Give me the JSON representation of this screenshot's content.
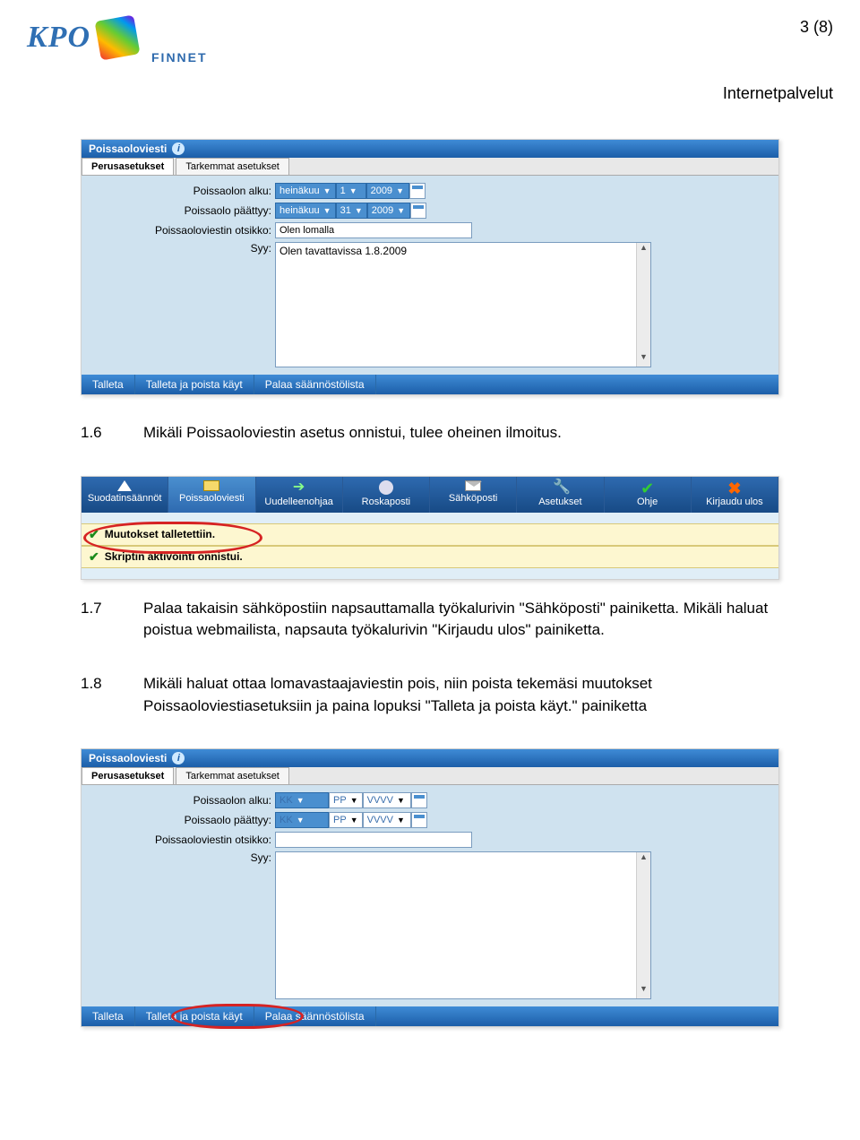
{
  "page_number": "3 (8)",
  "service_label": "Internetpalvelut",
  "logo": {
    "text": "KPO",
    "subtext": "FINNET"
  },
  "ui1": {
    "title": "Poissaoloviesti",
    "tabs": [
      "Perusasetukset",
      "Tarkemmat asetukset"
    ],
    "labels": {
      "start": "Poissaolon alku:",
      "end": "Poissaolo päättyy:",
      "subject": "Poissaoloviestin otsikko:",
      "reason": "Syy:"
    },
    "values": {
      "start_month": "heinäkuu",
      "start_day": "1",
      "start_year": "2009",
      "end_month": "heinäkuu",
      "end_day": "31",
      "end_year": "2009",
      "subject": "Olen lomalla",
      "reason": "Olen tavattavissa 1.8.2009"
    },
    "buttons": {
      "save": "Talleta",
      "save_remove": "Talleta ja poista käyt",
      "back": "Palaa säännöstölista"
    }
  },
  "para16_num": "1.6",
  "para16_txt": "Mikäli Poissaoloviestin asetus onnistui, tulee oheinen ilmoitus.",
  "toolbar": {
    "items": [
      "Suodatinsäännöt",
      "Poissaoloviesti",
      "Uudelleenohjaa",
      "Roskaposti",
      "Sähköposti",
      "Asetukset",
      "Ohje",
      "Kirjaudu ulos"
    ],
    "messages": [
      "Muutokset talletettiin.",
      "Skriptin aktivointi onnistui."
    ]
  },
  "para17_num": "1.7",
  "para17_txt": "Palaa takaisin sähköpostiin napsauttamalla työkalurivin \"Sähköposti\" painiketta. Mikäli haluat poistua webmailista, napsauta työkalurivin \"Kirjaudu ulos\" painiketta.",
  "para18_num": "1.8",
  "para18_txt": "Mikäli haluat ottaa lomavastaajaviestin pois, niin poista tekemäsi muutokset Poissaoloviestiasetuksiin ja paina lopuksi \"Talleta ja poista käyt.\" painiketta",
  "ui2": {
    "title": "Poissaoloviesti",
    "tabs": [
      "Perusasetukset",
      "Tarkemmat asetukset"
    ],
    "labels": {
      "start": "Poissaolon alku:",
      "end": "Poissaolo päättyy:",
      "subject": "Poissaoloviestin otsikko:",
      "reason": "Syy:"
    },
    "placeholders": {
      "month": "KK",
      "day": "PP",
      "year": "VVVV"
    },
    "buttons": {
      "save": "Talleta",
      "save_remove": "Talleta ja poista käyt",
      "back": "Palaa säännöstölista"
    }
  }
}
